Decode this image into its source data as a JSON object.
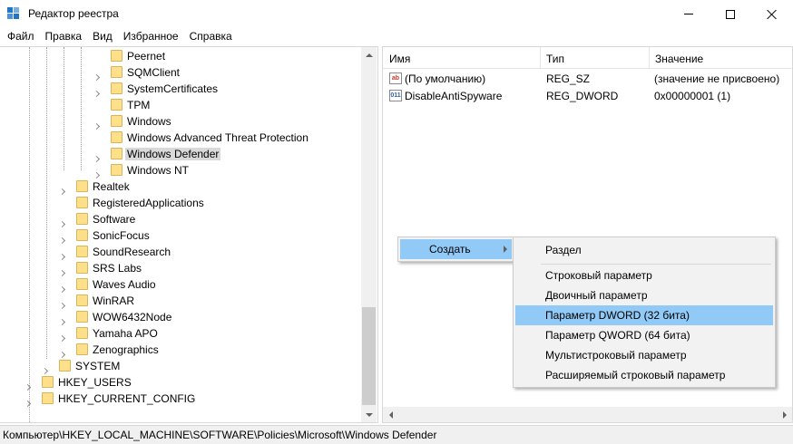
{
  "window": {
    "title": "Редактор реестра",
    "accent_color": "#1e76c9"
  },
  "menu": [
    "Файл",
    "Правка",
    "Вид",
    "Избранное",
    "Справка"
  ],
  "tree": {
    "items": [
      {
        "label": "Peernet",
        "expander": false
      },
      {
        "label": "SQMClient",
        "expander": true
      },
      {
        "label": "SystemCertificates",
        "expander": true
      },
      {
        "label": "TPM",
        "expander": false
      },
      {
        "label": "Windows",
        "expander": true
      },
      {
        "label": "Windows Advanced Threat Protection",
        "expander": false
      },
      {
        "label": "Windows Defender",
        "expander": true,
        "selected": true
      },
      {
        "label": "Windows NT",
        "expander": true
      },
      {
        "label": "Realtek",
        "expander": true
      },
      {
        "label": "RegisteredApplications",
        "expander": false
      },
      {
        "label": "Software",
        "expander": true
      },
      {
        "label": "SonicFocus",
        "expander": true
      },
      {
        "label": "SoundResearch",
        "expander": true
      },
      {
        "label": "SRS Labs",
        "expander": true
      },
      {
        "label": "Waves Audio",
        "expander": true
      },
      {
        "label": "WinRAR",
        "expander": true
      },
      {
        "label": "WOW6432Node",
        "expander": true
      },
      {
        "label": "Yamaha APO",
        "expander": true
      },
      {
        "label": "Zenographics",
        "expander": true
      },
      {
        "label": "SYSTEM",
        "expander": true
      },
      {
        "label": "HKEY_USERS",
        "expander": true
      },
      {
        "label": "HKEY_CURRENT_CONFIG",
        "expander": true
      }
    ]
  },
  "list": {
    "columns": [
      "Имя",
      "Тип",
      "Значение"
    ],
    "rows": [
      {
        "icon": "string-value-icon",
        "name": "(По умолчанию)",
        "type": "REG_SZ",
        "value": "(значение не присвоено)"
      },
      {
        "icon": "binary-value-icon",
        "name": "DisableAntiSpyware",
        "type": "REG_DWORD",
        "value": "0x00000001 (1)"
      }
    ]
  },
  "context_menu": {
    "item": "Создать",
    "submenu": [
      "Раздел",
      "Строковый параметр",
      "Двоичный параметр",
      "Параметр DWORD (32 бита)",
      "Параметр QWORD (64 бита)",
      "Мультистроковый параметр",
      "Расширяемый строковый параметр"
    ],
    "highlighted": "Параметр DWORD (32 бита)",
    "highlight_color": "#91c9f7"
  },
  "status": {
    "path": "Компьютер\\HKEY_LOCAL_MACHINE\\SOFTWARE\\Policies\\Microsoft\\Windows Defender"
  }
}
